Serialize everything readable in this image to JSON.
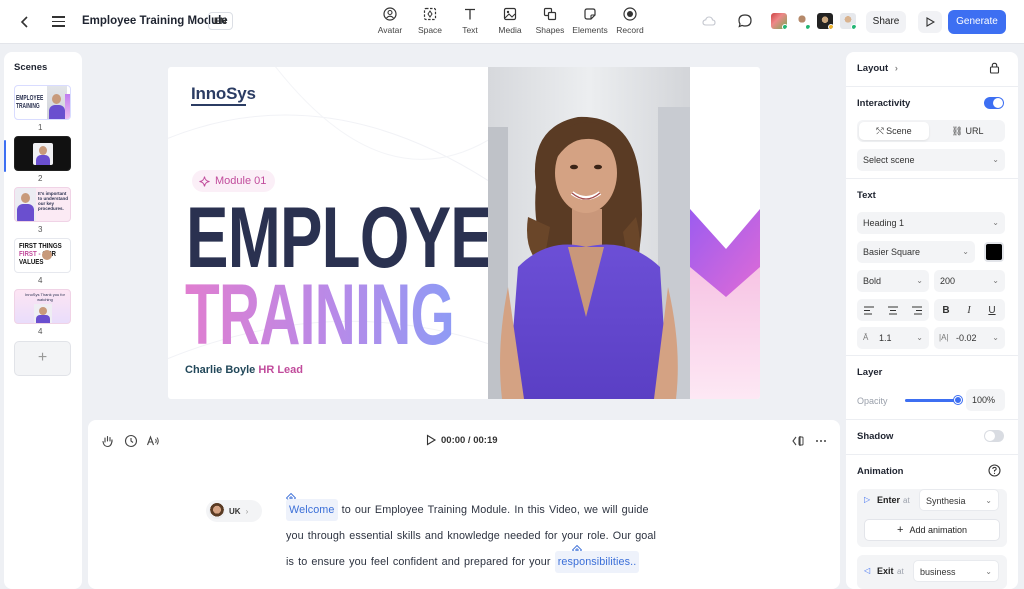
{
  "header": {
    "title": "Employee Training Module",
    "lang": "EN",
    "tools": [
      {
        "label": "Avatar",
        "icon": "avatar-icon"
      },
      {
        "label": "Space",
        "icon": "space-icon"
      },
      {
        "label": "Text",
        "icon": "text-icon"
      },
      {
        "label": "Media",
        "icon": "media-icon"
      },
      {
        "label": "Shapes",
        "icon": "shapes-icon"
      },
      {
        "label": "Elements",
        "icon": "elements-icon"
      },
      {
        "label": "Record",
        "icon": "record-icon"
      }
    ],
    "share_label": "Share",
    "generate_label": "Generate"
  },
  "scenes": {
    "title": "Scenes",
    "items": [
      {
        "num": "1",
        "text": "EMPLOYEE TRAINING"
      },
      {
        "num": "2",
        "text": ""
      },
      {
        "num": "3",
        "text": "It's important to understand our key procedures."
      },
      {
        "num": "4",
        "text_a": "FIRST THINGS",
        "text_b": "FIRST - ",
        "text_c": "OUR",
        "text_d": "VALUES"
      },
      {
        "num": "4",
        "text": "InnoSys  Thank you for watching"
      }
    ],
    "add_symbol": "+"
  },
  "canvas": {
    "logo": "InnoSys",
    "module_label": "Module 01",
    "headline_1": "EMPLOYEE",
    "headline_2": "TRAINING",
    "presenter_name": "Charlie Boyle",
    "presenter_role": "HR Lead"
  },
  "script": {
    "time": "00:00 / 00:19",
    "speaker": "UK",
    "line1_highlight": "Welcome",
    "line1_rest": " to our Employee Training Module. In this Video, we will guide",
    "line2": "you through essential skills and knowledge needed for your role. Our goal",
    "line3_start": "is to ensure you feel confident and prepared for your ",
    "line3_highlight": "responsibilities.."
  },
  "props": {
    "layout_title": "Layout",
    "interactivity_title": "Interactivity",
    "interactivity_on": true,
    "seg_scene": "Scene",
    "seg_url": "URL",
    "select_scene": "Select scene",
    "text_title": "Text",
    "heading": "Heading 1",
    "font": "Basier Square",
    "weight": "Bold",
    "size": "200",
    "line_height": "1.1",
    "letter_spacing": "-0.02",
    "layer_title": "Layer",
    "opacity_label": "Opacity",
    "opacity_value": "100%",
    "opacity": 1.0,
    "shadow_title": "Shadow",
    "shadow_on": false,
    "animation_title": "Animation",
    "enter_label": "Enter",
    "enter_at": "at",
    "enter_value": "Synthesia",
    "add_animation": "Add animation",
    "exit_label": "Exit",
    "exit_at": "at",
    "exit_value": "business"
  },
  "colors": {
    "accent": "#3d6ff2",
    "headline_dark": "#2a3150",
    "pink": "#c14c9c",
    "text_color_swatch": "#000000"
  }
}
